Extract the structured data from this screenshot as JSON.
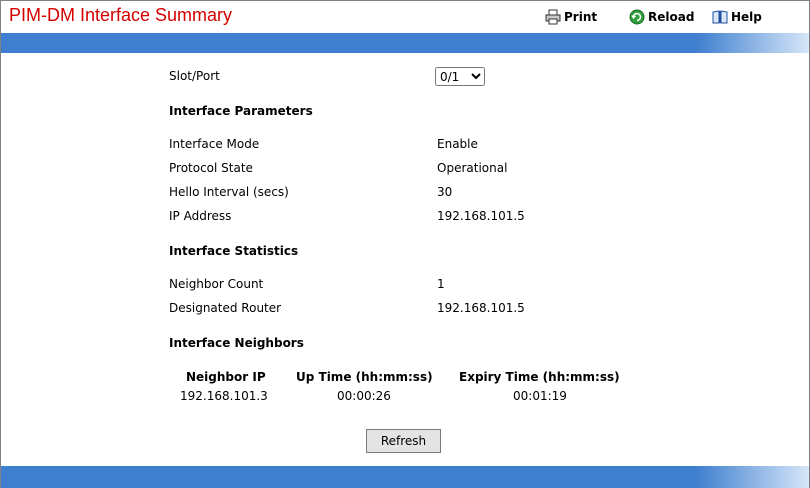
{
  "header": {
    "title": "PIM-DM Interface Summary",
    "toolbar": {
      "print_label": "Print",
      "reload_label": "Reload",
      "help_label": "Help"
    }
  },
  "form": {
    "slot_port_label": "Slot/Port",
    "slot_port_value": "0/1",
    "slot_port_options": [
      "0/1"
    ]
  },
  "interface_parameters": {
    "heading": "Interface Parameters",
    "rows": [
      {
        "label": "Interface Mode",
        "value": "Enable"
      },
      {
        "label": "Protocol State",
        "value": "Operational"
      },
      {
        "label": "Hello Interval (secs)",
        "value": "30"
      },
      {
        "label": "IP Address",
        "value": "192.168.101.5"
      }
    ]
  },
  "interface_statistics": {
    "heading": "Interface Statistics",
    "rows": [
      {
        "label": "Neighbor Count",
        "value": "1"
      },
      {
        "label": "Designated Router",
        "value": "192.168.101.5"
      }
    ]
  },
  "interface_neighbors": {
    "heading": "Interface Neighbors",
    "columns": [
      "Neighbor IP",
      "Up Time (hh:mm:ss)",
      "Expiry Time (hh:mm:ss)"
    ],
    "rows": [
      [
        "192.168.101.3",
        "00:00:26",
        "00:01:19"
      ]
    ]
  },
  "actions": {
    "refresh_label": "Refresh"
  },
  "colors": {
    "title": "#d40000",
    "band": "#3f7fcf"
  }
}
